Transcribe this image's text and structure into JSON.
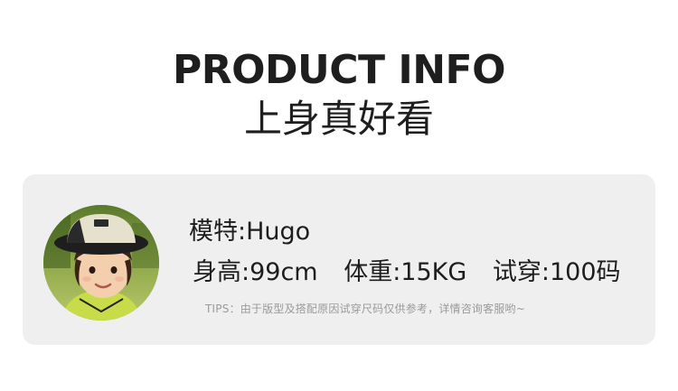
{
  "header": {
    "title_en": "PRODUCT INFO",
    "title_cn": "上身真好看"
  },
  "model": {
    "name_line": "模特:Hugo",
    "height": "身高:99cm",
    "weight": "体重:15KG",
    "size_tried": "试穿:100码",
    "tips": "TIPS：由于版型及搭配原因试穿尺码仅供参考，详情咨询客服哟~",
    "avatar_icon": "child-model-photo"
  }
}
